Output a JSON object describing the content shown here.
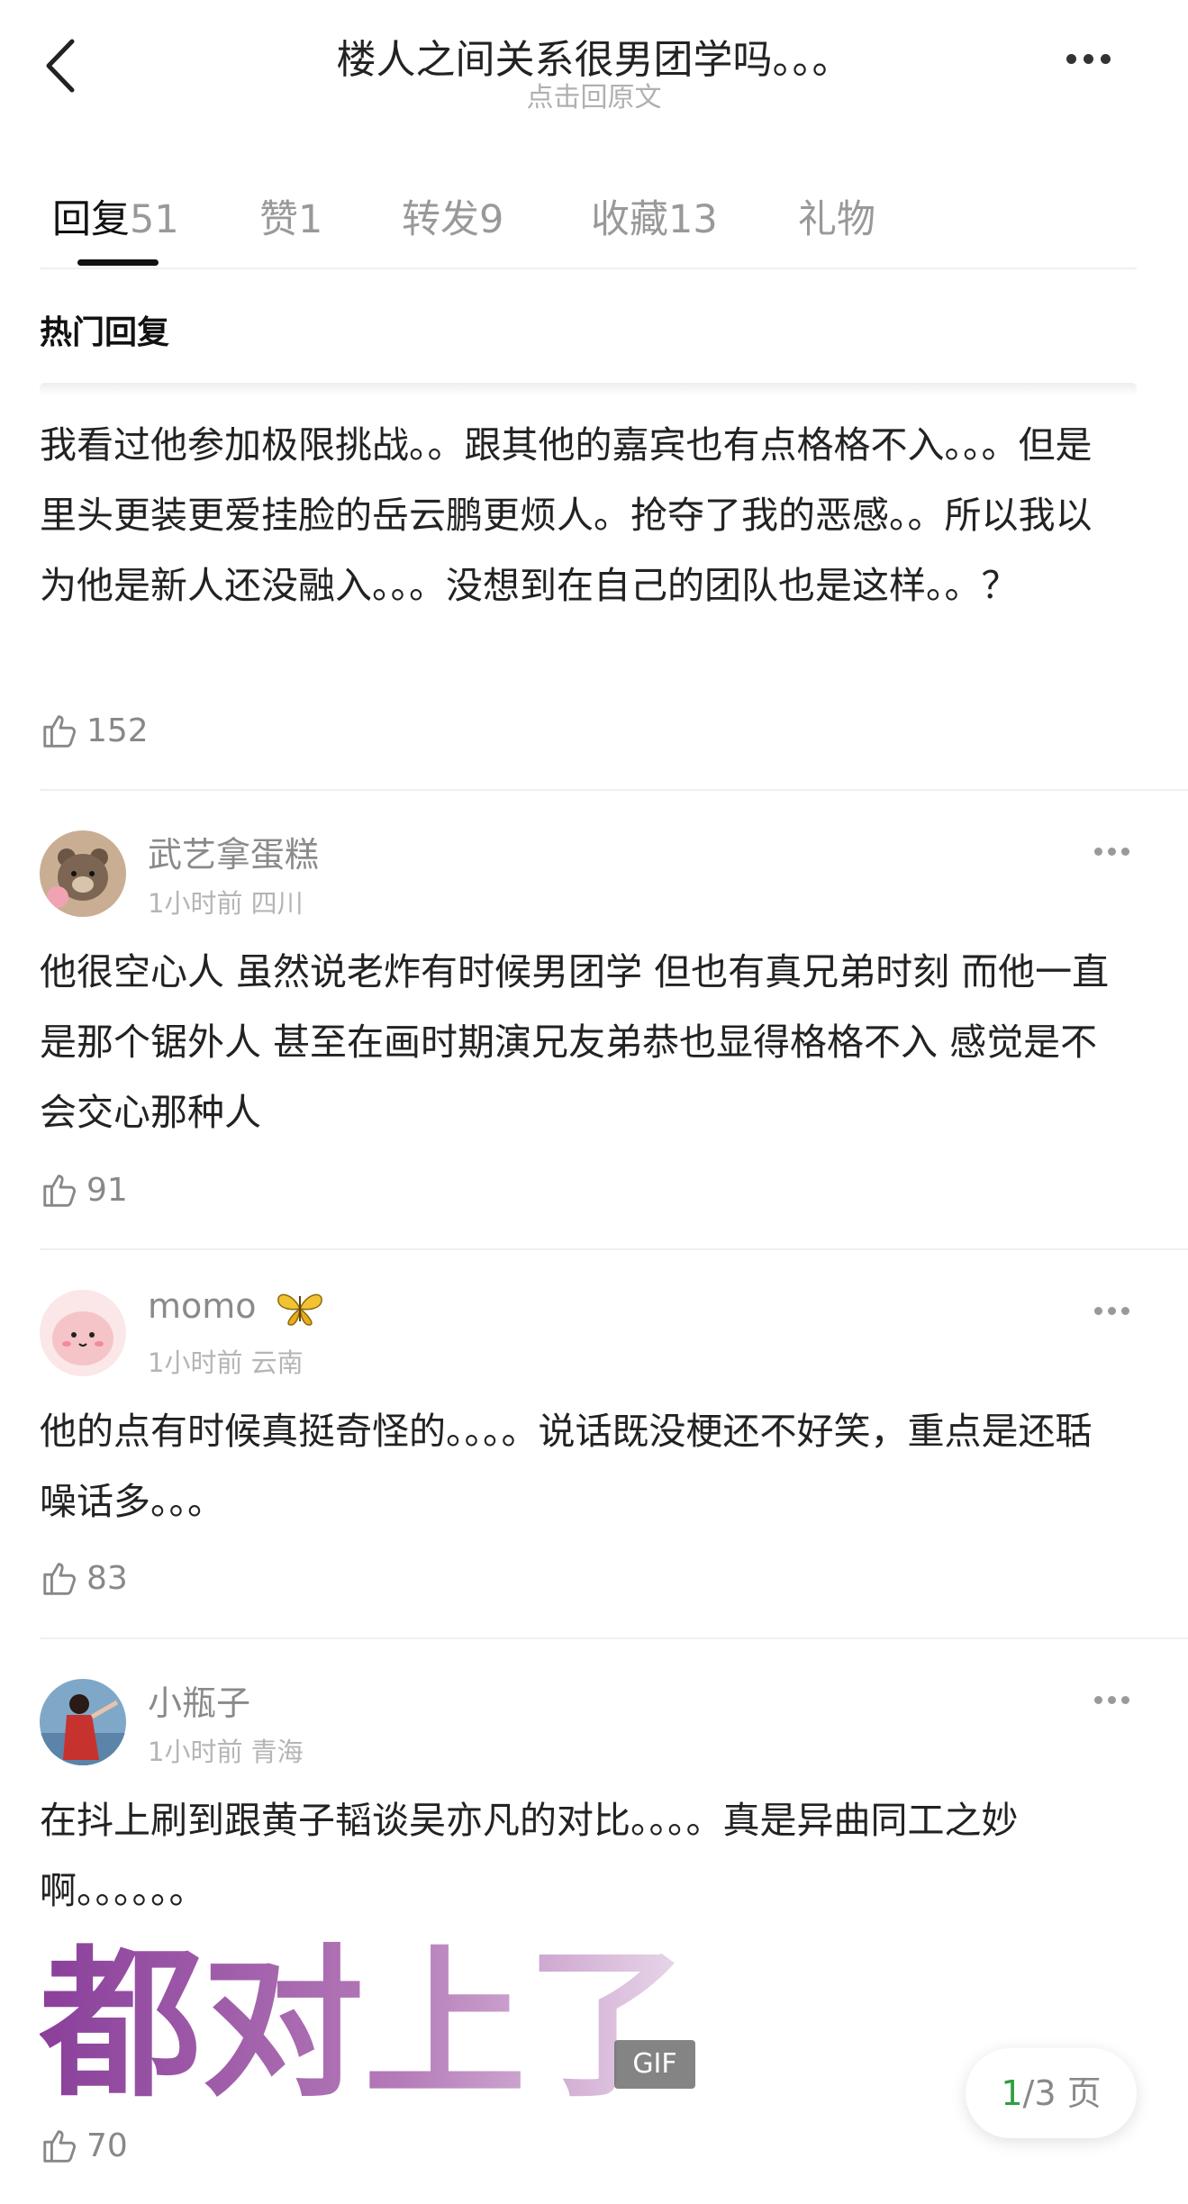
{
  "header": {
    "title": "楼人之间关系很男团学吗。。。",
    "subtitle": "点击回原文"
  },
  "tabs": [
    {
      "label": "回复",
      "count": "51",
      "active": true
    },
    {
      "label": "赞",
      "count": "1"
    },
    {
      "label": "转发",
      "count": "9"
    },
    {
      "label": "收藏",
      "count": "13"
    },
    {
      "label": "礼物",
      "count": ""
    }
  ],
  "section_title": "热门回复",
  "posts": [
    {
      "text": "我看过他参加极限挑战。。跟其他的嘉宾也有点格格不入。。。但是里头更装更爱挂脸的岳云鹏更烦人。抢夺了我的恶感。。所以我以为他是新人还没融入。。。没想到在自己的团队也是这样。。？",
      "likes": "152"
    },
    {
      "username": "武艺拿蛋糕",
      "time": "1小时前",
      "location": "四川",
      "text": "他很空心人 虽然说老炸有时候男团学 但也有真兄弟时刻 而他一直是那个锯外人 甚至在画时期演兄友弟恭也显得格格不入 感觉是不会交心那种人",
      "likes": "91"
    },
    {
      "username": "momo",
      "badge": "butterfly-icon",
      "time": "1小时前",
      "location": "云南",
      "text": "他的点有时候真挺奇怪的。。。。说话既没梗还不好笑，重点是还聒噪话多。。。",
      "likes": "83"
    },
    {
      "username": "小瓶子",
      "time": "1小时前",
      "location": "青海",
      "text": "在抖上刷到跟黄子韬谈吴亦凡的对比。。。。真是异曲同工之妙啊。。。。。。",
      "gif_text": "都对上了",
      "gif_badge": "GIF",
      "likes": "70"
    }
  ],
  "pager": {
    "current": "1",
    "total": "/3",
    "unit": "页"
  },
  "colors": {
    "accent_green": "#2f9e45",
    "gif_purple": "#8a3f9a"
  }
}
